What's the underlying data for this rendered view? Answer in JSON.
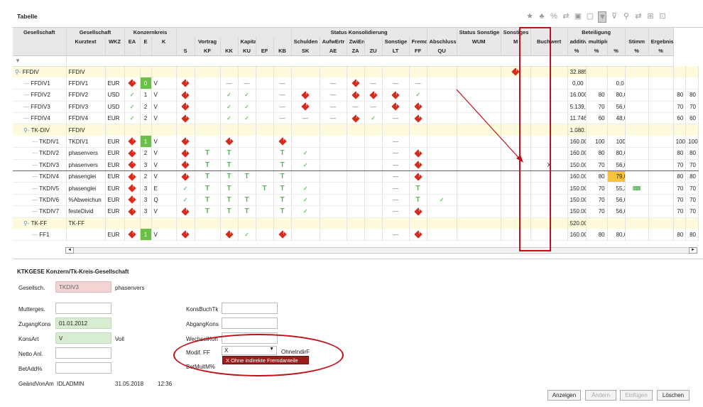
{
  "title": "Tabelle",
  "toolbar": {
    "icons": [
      "star-icon",
      "hierarchy-icon",
      "percent-icon",
      "refresh-icon",
      "lock-icon",
      "unlock-icon",
      "filter-icon",
      "filter-clear-icon",
      "search-icon",
      "refresh2-icon",
      "columns-icon",
      "expand-icon"
    ],
    "glyphs": [
      "★",
      "♣",
      "%",
      "⇄",
      "▣",
      "▢",
      "▼",
      "⊽",
      "⚲",
      "⇄",
      "⊞",
      "⊡"
    ]
  },
  "header": {
    "group1": [
      "Gesellschaft",
      "Gesellschaft",
      "",
      "Konzernkreis",
      "",
      "",
      "",
      "",
      "",
      "Status Konsolidierung",
      "",
      "",
      "",
      "",
      "",
      "",
      "Status Sonstige",
      "Sonstiges",
      "",
      "Beteiligung",
      "",
      ""
    ],
    "group2": [
      "",
      "Kurztext",
      "WKZ",
      "EA",
      "E",
      "K",
      "",
      "Vortrag",
      "",
      "Kapital",
      "",
      "",
      "Schulden",
      "AufwErtr",
      "ZwiErg",
      "",
      "Sonstige",
      "Fremd",
      "Abschluss",
      "WUM",
      "M",
      "Buchwert",
      "additiv",
      "multiple",
      "",
      "Stimm",
      "Ergebnis"
    ],
    "group3": [
      "",
      "",
      "",
      "",
      "",
      "",
      "S",
      "KF",
      "KK",
      "KU",
      "EF",
      "KB",
      "SK",
      "AE",
      "ZA",
      "ZU",
      "LT",
      "FF",
      "QU",
      "",
      "",
      "",
      "%",
      "%",
      "%",
      "%",
      "%"
    ]
  },
  "rows": [
    {
      "type": "grp",
      "name": "FFDIV",
      "indent": 0,
      "tree": "⚲-",
      "kurz": "FFDIV",
      "wkz": "",
      "ea": "",
      "e": "",
      "k": "",
      "cells": [
        "",
        "",
        "",
        "",
        "",
        "",
        "",
        "",
        "",
        "",
        "",
        "",
        "",
        ""
      ],
      "wum": "err",
      "m": "",
      "buch": "32.885,69",
      "add": "",
      "mul": "",
      "mul2": "",
      "stimm": "",
      "erg": ""
    },
    {
      "type": "data",
      "name": "FFDIV1",
      "indent": 1,
      "kurz": "FFDIV1",
      "wkz": "EUR",
      "ea": "err",
      "e": "0",
      "eg": true,
      "k": "V",
      "cells": [
        "err",
        "",
        "—",
        "—",
        "",
        "—",
        "",
        "—",
        "err",
        "—",
        "—",
        "—",
        "",
        ""
      ],
      "wum": "",
      "m": "",
      "buch": "0,00",
      "add": "",
      "mul": "0,0",
      "mul2": "",
      "stimm": "",
      "erg": ""
    },
    {
      "type": "data",
      "name": "FFDIV2",
      "indent": 1,
      "kurz": "FFDIV2",
      "wkz": "USD",
      "ea": "ok",
      "e": "1",
      "k": "V",
      "cells": [
        "err",
        "",
        "ok",
        "ok",
        "",
        "—",
        "err",
        "—",
        "err",
        "err",
        "err",
        "ok",
        "",
        ""
      ],
      "wum": "",
      "m": "",
      "buch": "16.000,00",
      "add": "80",
      "mul": "80,0",
      "mul2": "",
      "stimm": "80",
      "erg": "80"
    },
    {
      "type": "data",
      "name": "FFDIV3",
      "indent": 1,
      "kurz": "FFDIV3",
      "wkz": "USD",
      "ea": "ok",
      "e": "2",
      "k": "V",
      "cells": [
        "err",
        "",
        "ok",
        "ok",
        "",
        "—",
        "err",
        "—",
        "—",
        "—",
        "err",
        "err",
        "",
        ""
      ],
      "wum": "",
      "m": "",
      "buch": "5.139,12",
      "add": "70",
      "mul": "56,0",
      "mul2": "",
      "stimm": "70",
      "erg": "70"
    },
    {
      "type": "data",
      "name": "FFDIV4",
      "indent": 1,
      "kurz": "FFDIV4",
      "wkz": "EUR",
      "ea": "ok",
      "e": "2",
      "k": "V",
      "cells": [
        "err",
        "",
        "ok",
        "ok",
        "",
        "—",
        "—",
        "—",
        "err",
        "ok",
        "—",
        "err",
        "",
        ""
      ],
      "wum": "",
      "m": "",
      "buch": "11.746,57",
      "add": "60",
      "mul": "48,0",
      "mul2": "",
      "stimm": "60",
      "erg": "60"
    },
    {
      "type": "grp",
      "name": "TK-DIV",
      "indent": 1,
      "tree": "⚲-",
      "kurz": "FFDIV",
      "wkz": "",
      "ea": "",
      "e": "",
      "k": "",
      "cells": [
        "",
        "",
        "",
        "",
        "",
        "",
        "",
        "",
        "",
        "",
        "",
        "",
        "",
        ""
      ],
      "wum": "",
      "m": "",
      "buch": "1.080.000,00",
      "add": "",
      "mul": "",
      "mul2": "",
      "stimm": "",
      "erg": ""
    },
    {
      "type": "data",
      "name": "TKDIV1",
      "indent": 2,
      "kurz": "TKDIV1",
      "wkz": "EUR",
      "ea": "err",
      "e": "1",
      "eg": true,
      "k": "V",
      "cells": [
        "err",
        "",
        "err",
        "",
        "",
        "err",
        "",
        "",
        "",
        "",
        "—",
        "",
        "",
        ""
      ],
      "wum": "",
      "m": "",
      "buch": "160.000,00",
      "add": "100",
      "mul": "100,0",
      "mul2": "",
      "stimm": "100",
      "erg": "100"
    },
    {
      "type": "data",
      "name": "TKDIV2",
      "indent": 2,
      "kurz": "phasenvers",
      "wkz": "EUR",
      "ea": "err",
      "e": "2",
      "k": "V",
      "cells": [
        "err",
        "T",
        "T",
        "",
        "",
        "T",
        "ok",
        "",
        "",
        "",
        "—",
        "err",
        "",
        ""
      ],
      "wum": "",
      "m": "",
      "buch": "160.000,00",
      "add": "80",
      "mul": "80,0",
      "mul2": "",
      "stimm": "80",
      "erg": "80"
    },
    {
      "type": "data",
      "sel": true,
      "name": "TKDIV3",
      "indent": 2,
      "kurz": "phasenvers",
      "wkz": "EUR",
      "ea": "err",
      "e": "3",
      "k": "V",
      "cells": [
        "err",
        "T",
        "T",
        "",
        "",
        "T",
        "ok",
        "",
        "",
        "",
        "—",
        "err",
        "",
        ""
      ],
      "wum": "",
      "m": "X",
      "buch": "150.000,00",
      "add": "70",
      "mul": "56,0",
      "mul2": "",
      "stimm": "70",
      "erg": "70"
    },
    {
      "type": "data",
      "name": "TKDIV4",
      "indent": 2,
      "kurz": "phasenglei",
      "wkz": "EUR",
      "ea": "err",
      "e": "2",
      "k": "V",
      "cells": [
        "err",
        "T",
        "T",
        "T",
        "",
        "T",
        "",
        "",
        "",
        "",
        "—",
        "err",
        "",
        ""
      ],
      "wum": "",
      "m": "",
      "buch": "160.000,00",
      "add": "80",
      "mul": "79,0",
      "muly": true,
      "mul2": "",
      "stimm": "80",
      "erg": "80"
    },
    {
      "type": "data",
      "name": "TKDIV5",
      "indent": 2,
      "kurz": "phasenglei",
      "wkz": "EUR",
      "ea": "err",
      "e": "3",
      "k": "E",
      "cells": [
        "ok",
        "T",
        "T",
        "",
        "T",
        "T",
        "ok",
        "",
        "",
        "",
        "—",
        "T",
        "",
        ""
      ],
      "wum": "",
      "m": "",
      "buch": "150.000,00",
      "add": "70",
      "mul": "55,3",
      "mul2": "calc",
      "stimm": "70",
      "erg": "70"
    },
    {
      "type": "data",
      "name": "TKDIV6",
      "indent": 2,
      "kurz": "%Abweichun",
      "wkz": "EUR",
      "ea": "err",
      "e": "3",
      "k": "Q",
      "cells": [
        "ok",
        "T",
        "T",
        "T",
        "",
        "T",
        "ok",
        "",
        "",
        "",
        "—",
        "T",
        "ok",
        ""
      ],
      "wum": "",
      "m": "",
      "buch": "150.000,00",
      "add": "70",
      "mul": "56,0",
      "mul2": "",
      "stimm": "70",
      "erg": "70"
    },
    {
      "type": "data",
      "name": "TKDIV7",
      "indent": 2,
      "kurz": "festeDivid",
      "wkz": "EUR",
      "ea": "err",
      "e": "3",
      "k": "V",
      "cells": [
        "err",
        "T",
        "T",
        "T",
        "",
        "T",
        "ok",
        "",
        "",
        "",
        "—",
        "err",
        "",
        ""
      ],
      "wum": "",
      "m": "",
      "buch": "150.000,00",
      "add": "70",
      "mul": "56,0",
      "mul2": "",
      "stimm": "70",
      "erg": "70"
    },
    {
      "type": "grp",
      "name": "TK-FF",
      "indent": 1,
      "tree": "⚲-",
      "kurz": "TK-FF",
      "wkz": "",
      "ea": "",
      "e": "",
      "k": "",
      "cells": [
        "",
        "",
        "",
        "",
        "",
        "",
        "",
        "",
        "",
        "",
        "",
        "",
        "",
        ""
      ],
      "wum": "",
      "m": "",
      "buch": "520.000,00",
      "add": "",
      "mul": "",
      "mul2": "",
      "stimm": "",
      "erg": ""
    },
    {
      "type": "data",
      "name": "FF1",
      "indent": 2,
      "kurz": "",
      "wkz": "EUR",
      "ea": "err",
      "e": "1",
      "eg": true,
      "k": "V",
      "cells": [
        "err",
        "",
        "err",
        "ok",
        "",
        "err",
        "",
        "",
        "",
        "",
        "—",
        "err",
        "",
        ""
      ],
      "wum": "",
      "m": "",
      "buch": "160.000,00",
      "add": "80",
      "mul": "80,0",
      "mul2": "",
      "stimm": "80",
      "erg": "80"
    }
  ],
  "panel": {
    "title": "KTKGESE Konzern/Tk-Kreis-Gesellschaft",
    "gesellsch_label": "Gesellsch.",
    "gesellsch_value": "TKDIV3",
    "gesellsch_text": "phasenvers",
    "mutterges_label": "Mutterges.",
    "zugang_label": "ZugangKons",
    "zugang_value": "01.01.2012",
    "konsart_label": "KonsArt",
    "konsart_value": "V",
    "konsart_text": "Voll",
    "netto_label": "Netto Anl.",
    "betadd_label": "BetAdd%",
    "geaend_label": "GeändVonAm",
    "geaend_user": "IDLADMIN",
    "geaend_date": "31.05.2018",
    "geaend_time": "12:36",
    "konsbuch_label": "KonsBuchTk",
    "abgang_label": "AbgangKons",
    "wechsel_label": "WechselKon",
    "modif_label": "Modif. FF",
    "modif_value": "X",
    "modif_text": "OhneIndirF",
    "betmult_label": "BetMultM%",
    "dropdown_option": "X    Ohne indirekte Fremdanteile"
  },
  "buttons": {
    "anzeigen": "Anzeigen",
    "aendern": "Ändern",
    "einfuegen": "Einfügen",
    "loeschen": "Löschen"
  },
  "colors": {
    "highlight": "#c0101a",
    "group_row": "#fdfbdb",
    "ok": "#6abf6a",
    "error": "#d72b1e"
  }
}
